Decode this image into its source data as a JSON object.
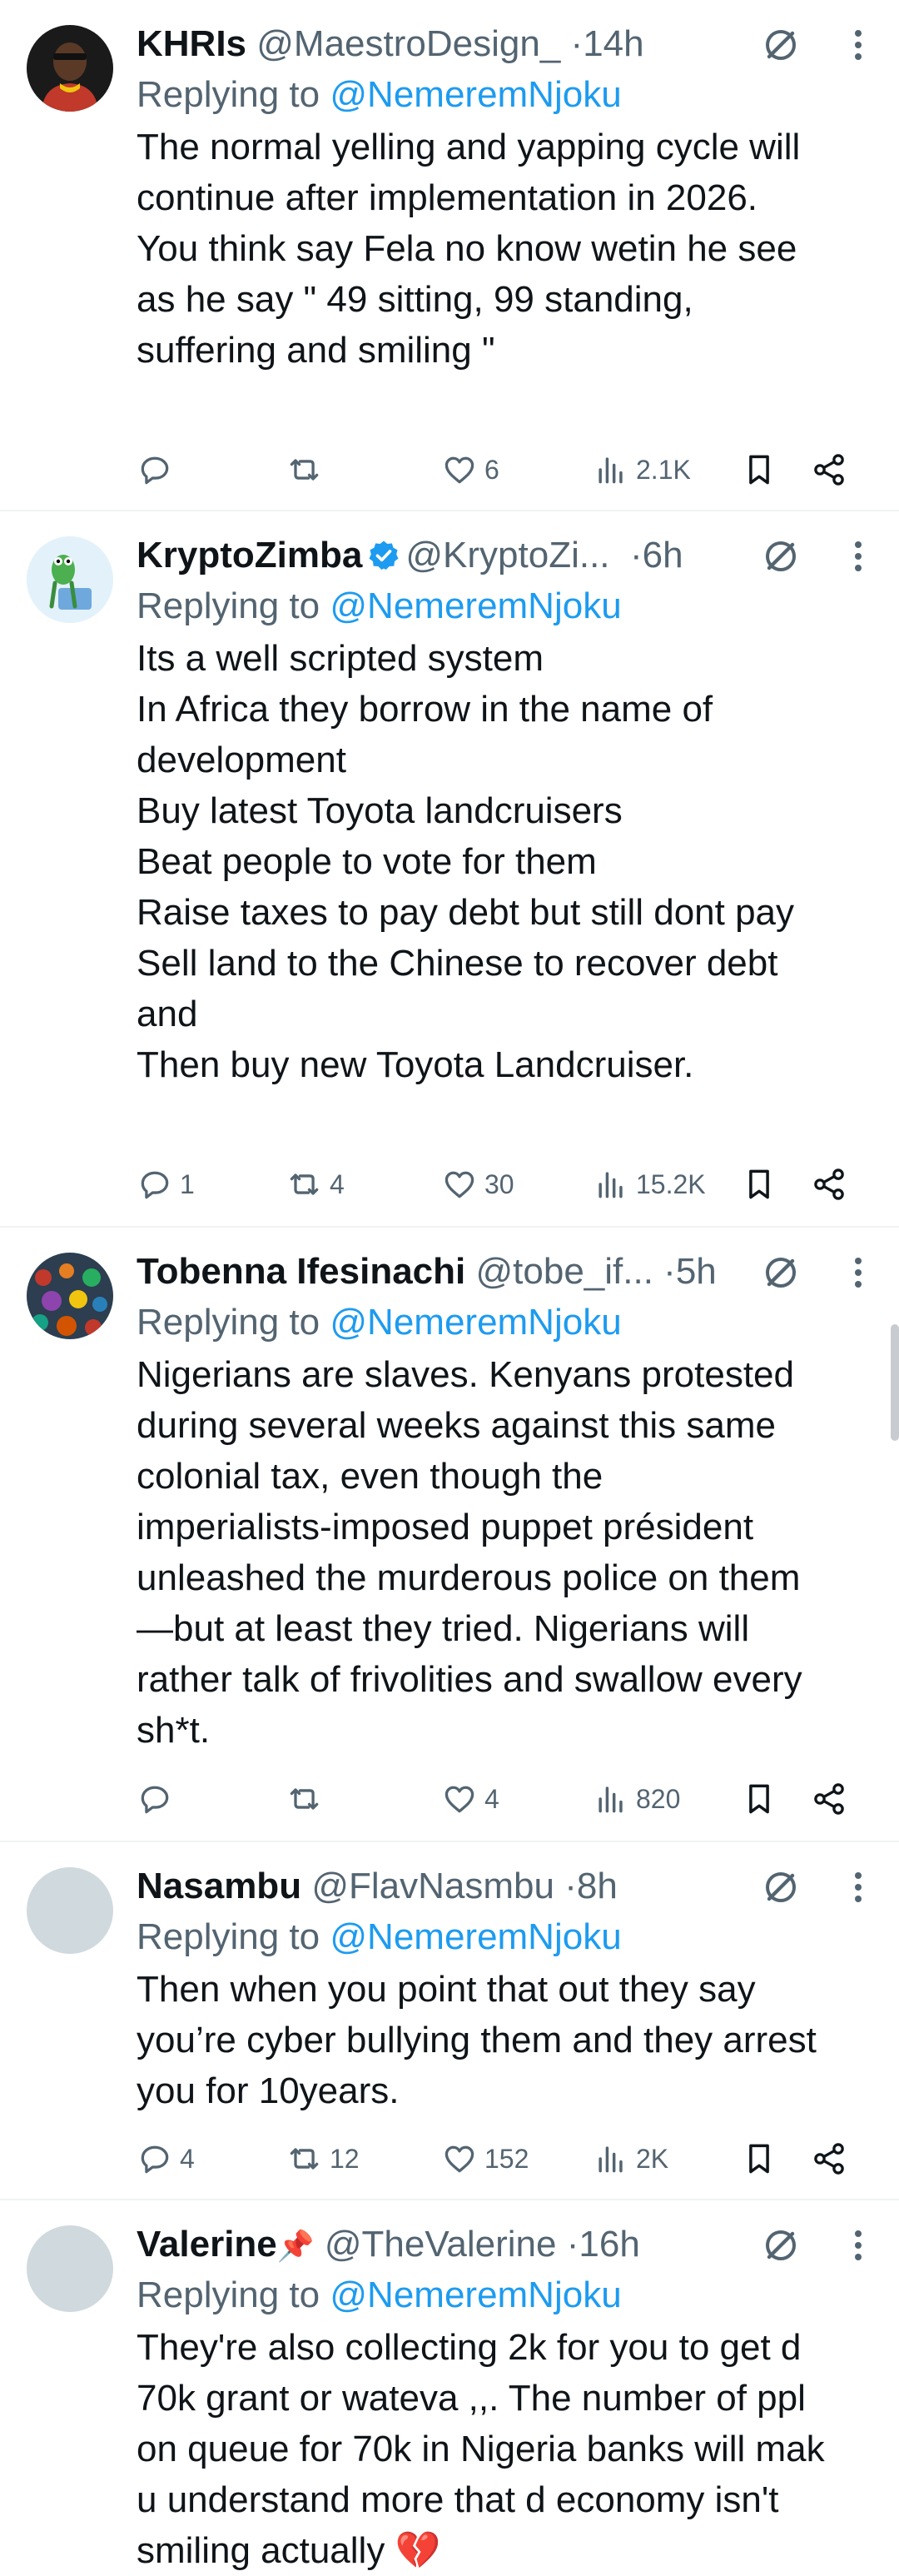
{
  "reply_prefix": "Replying to",
  "icons": {
    "reply": "reply-icon",
    "retweet": "retweet-icon",
    "like": "heart-icon",
    "views": "views-icon",
    "bookmark": "bookmark-icon",
    "share": "share-icon",
    "grok": "grok-icon",
    "more": "more-icon",
    "verified": "verified-badge-icon"
  },
  "colors": {
    "text": "#0f1419",
    "secondary": "#536471",
    "mention": "#1d9bf0",
    "verified": "#1d9bf0",
    "divider": "#eff3f4"
  },
  "tweets": [
    {
      "name": "KHRIs",
      "handle": "@MaestroDesign_",
      "time": "14h",
      "mention": "@NemeremNjoku",
      "verified": false,
      "lines": [
        "The normal yelling and yapping cycle will",
        "continue after implementation in 2026.",
        "",
        "You think say Fela no know wetin he see",
        "as he say \" 49 sitting, 99 standing,",
        "suffering and smiling \""
      ],
      "stats": {
        "replies": "",
        "retweets": "",
        "likes": "6",
        "views": "2.1K"
      }
    },
    {
      "name": "KryptoZimba",
      "handle": "@KryptoZi...",
      "time": "6h",
      "mention": "@NemeremNjoku",
      "verified": true,
      "lines": [
        "Its a well scripted system",
        "",
        "In Africa they borrow in the name of",
        "development",
        "Buy latest Toyota landcruisers",
        "Beat people to vote for them",
        "Raise taxes to pay debt but still dont pay",
        "Sell land to the Chinese to recover debt",
        "and",
        "Then buy new Toyota Landcruiser."
      ],
      "stats": {
        "replies": "1",
        "retweets": "4",
        "likes": "30",
        "views": "15.2K"
      }
    },
    {
      "name": "Tobenna Ifesinachi",
      "handle": "@tobe_if...",
      "time": "5h",
      "mention": "@NemeremNjoku",
      "verified": false,
      "lines": [
        "Nigerians are slaves. Kenyans protested",
        "during several weeks against this same",
        "colonial tax, even though the",
        "imperialists-imposed puppet président",
        "unleashed the murderous police on them",
        "—but at least they tried. Nigerians will",
        "rather talk of frivolities and swallow every",
        "sh*t."
      ],
      "stats": {
        "replies": "",
        "retweets": "",
        "likes": "4",
        "views": "820"
      }
    },
    {
      "name": "Nasambu",
      "handle": "@FlavNasmbu",
      "time": "8h",
      "mention": "@NemeremNjoku",
      "verified": false,
      "lines": [
        "Then when you point that out they say",
        "you’re cyber bullying them and they arrest",
        "you for 10years."
      ],
      "stats": {
        "replies": "4",
        "retweets": "12",
        "likes": "152",
        "views": "2K"
      }
    },
    {
      "name": "Valerine",
      "name_emoji": "📌",
      "handle": "@TheValerine",
      "time": "16h",
      "mention": "@NemeremNjoku",
      "verified": false,
      "lines": [
        "They're also collecting 2k for you to get d",
        "70k grant or wateva ,,. The number of ppl",
        "on queue for 70k in Nigeria banks will mak",
        "u understand more that d economy isn't",
        "smiling actually 💔"
      ],
      "stats": null
    }
  ]
}
